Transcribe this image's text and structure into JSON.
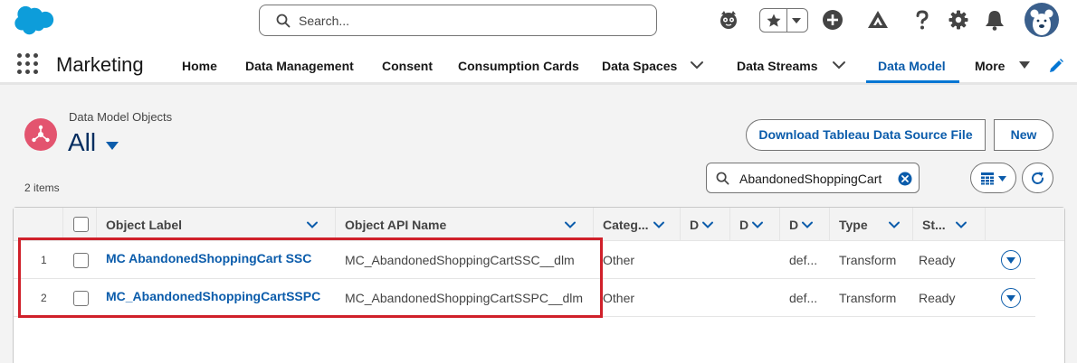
{
  "header": {
    "search_placeholder": "Search..."
  },
  "nav": {
    "app_name": "Marketing",
    "items": [
      {
        "label": "Home"
      },
      {
        "label": "Data Management"
      },
      {
        "label": "Consent"
      },
      {
        "label": "Consumption Cards"
      },
      {
        "label": "Data Spaces"
      },
      {
        "label": "Data Streams"
      },
      {
        "label": "Data Model"
      },
      {
        "label": "More"
      }
    ],
    "active_item": "Data Model"
  },
  "list": {
    "object_type": "Data Model Objects",
    "view_name": "All",
    "item_count": "2 items",
    "buttons": {
      "download": "Download Tableau Data Source File",
      "new": "New"
    },
    "search_value": "AbandonedShoppingCart"
  },
  "table": {
    "columns": [
      "Object Label",
      "Object API Name",
      "Categ...",
      "D",
      "D",
      "D",
      "Type",
      "St..."
    ],
    "rows": [
      {
        "num": "1",
        "label": "MC AbandonedShoppingCart SSC",
        "api_name": "MC_AbandonedShoppingCartSSC__dlm",
        "category": "Other",
        "d3": "def...",
        "type": "Transform",
        "status": "Ready"
      },
      {
        "num": "2",
        "label": "MC_AbandonedShoppingCartSSPC",
        "api_name": "MC_AbandonedShoppingCartSSPC__dlm",
        "category": "Other",
        "d3": "def...",
        "type": "Transform",
        "status": "Ready"
      }
    ]
  },
  "colors": {
    "brand_blue": "#0176d3",
    "link_blue": "#0b5cab",
    "highlight_red": "#d0202a",
    "object_icon_pink": "#e3546f"
  }
}
